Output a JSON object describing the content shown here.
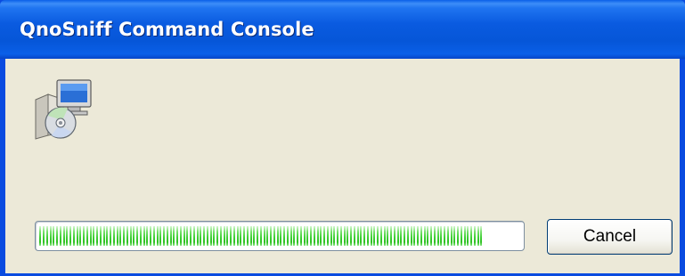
{
  "window": {
    "title": "QnoSniff Command Console",
    "icon": "setup-installer-icon"
  },
  "progress": {
    "fraction": 0.92
  },
  "buttons": {
    "cancel_label": "Cancel"
  },
  "colors": {
    "titlebar": "#0A5BE0",
    "window_bg": "#ECE9D8",
    "progress_green": "#3ECF34"
  }
}
